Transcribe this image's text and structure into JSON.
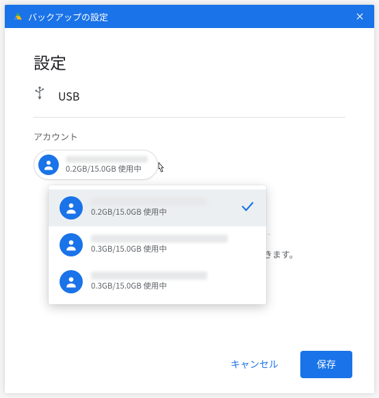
{
  "titlebar": {
    "title": "バックアップの設定"
  },
  "heading": "設定",
  "usb_label": "USB",
  "section_label": "アカウント",
  "selected_account": {
    "usage": "0.2GB/15.0GB 使用中"
  },
  "dropdown": {
    "items": [
      {
        "usage": "0.2GB/15.0GB 使用中",
        "selected": true
      },
      {
        "usage": "0.3GB/15.0GB 使用中",
        "selected": false
      },
      {
        "usage": "0.3GB/15.0GB 使用中",
        "selected": false
      }
    ]
  },
  "bg_hint_suffix": "スできます。",
  "footer": {
    "cancel": "キャンセル",
    "save": "保存"
  },
  "colors": {
    "primary": "#1a73e8"
  }
}
